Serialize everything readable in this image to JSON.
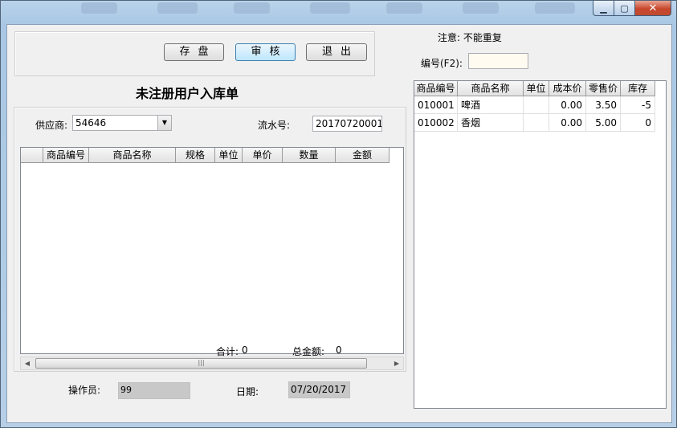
{
  "toolbar": {
    "save_label": "存盘",
    "audit_label": "审核",
    "exit_label": "退出"
  },
  "notice": "注意: 不能重复",
  "code_field": {
    "label": "编号(F2):",
    "value": ""
  },
  "form_title": "未注册用户入库单",
  "supplier": {
    "label": "供应商:",
    "value": "54646"
  },
  "serial": {
    "label": "流水号:",
    "value": "20170720001"
  },
  "entry_table": {
    "columns": [
      "",
      "商品编号",
      "商品名称",
      "规格",
      "单位",
      "单价",
      "数量",
      "金额"
    ]
  },
  "totals": {
    "count_label": "合计:",
    "count_value": "0",
    "amount_label": "总金额:",
    "amount_value": "0"
  },
  "operator": {
    "label": "操作员:",
    "value": "99"
  },
  "date": {
    "label": "日期:",
    "value": "07/20/2017"
  },
  "product_table": {
    "columns": [
      "商品编号",
      "商品名称",
      "单位",
      "成本价",
      "零售价",
      "库存"
    ],
    "rows": [
      [
        "010001",
        "啤酒",
        "",
        "0.00",
        "3.50",
        "-5"
      ],
      [
        "010002",
        "香烟",
        "",
        "0.00",
        "5.00",
        "0"
      ]
    ]
  }
}
